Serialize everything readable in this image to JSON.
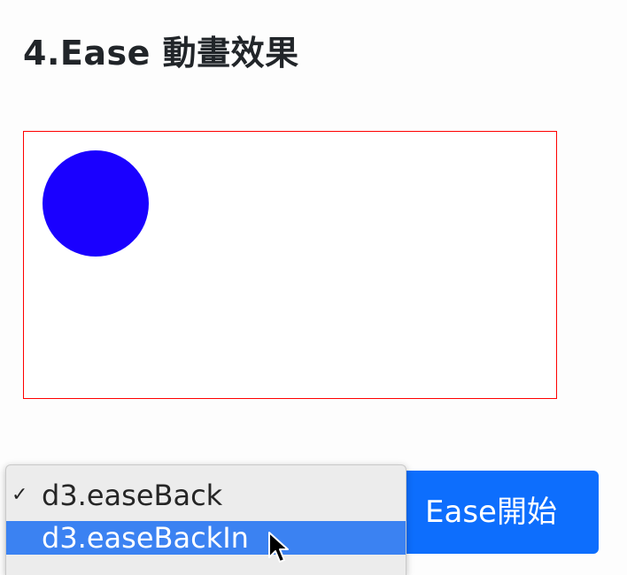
{
  "page": {
    "title": "4.Ease 動畫效果"
  },
  "stage": {
    "border_color": "#ff0000",
    "ball_color": "#1a00ff"
  },
  "controls": {
    "start_button_label": "Ease開始",
    "start_button_color": "#0d6efd",
    "dropdown": {
      "selected": "d3.easeBack",
      "options": [
        {
          "label": "d3.easeBack",
          "checked": true,
          "highlighted": false
        },
        {
          "label": "d3.easeBackIn",
          "checked": false,
          "highlighted": true
        }
      ],
      "highlight_color": "#3b82f2"
    }
  },
  "icons": {
    "check": "check-icon",
    "cursor": "mouse-pointer-icon"
  }
}
